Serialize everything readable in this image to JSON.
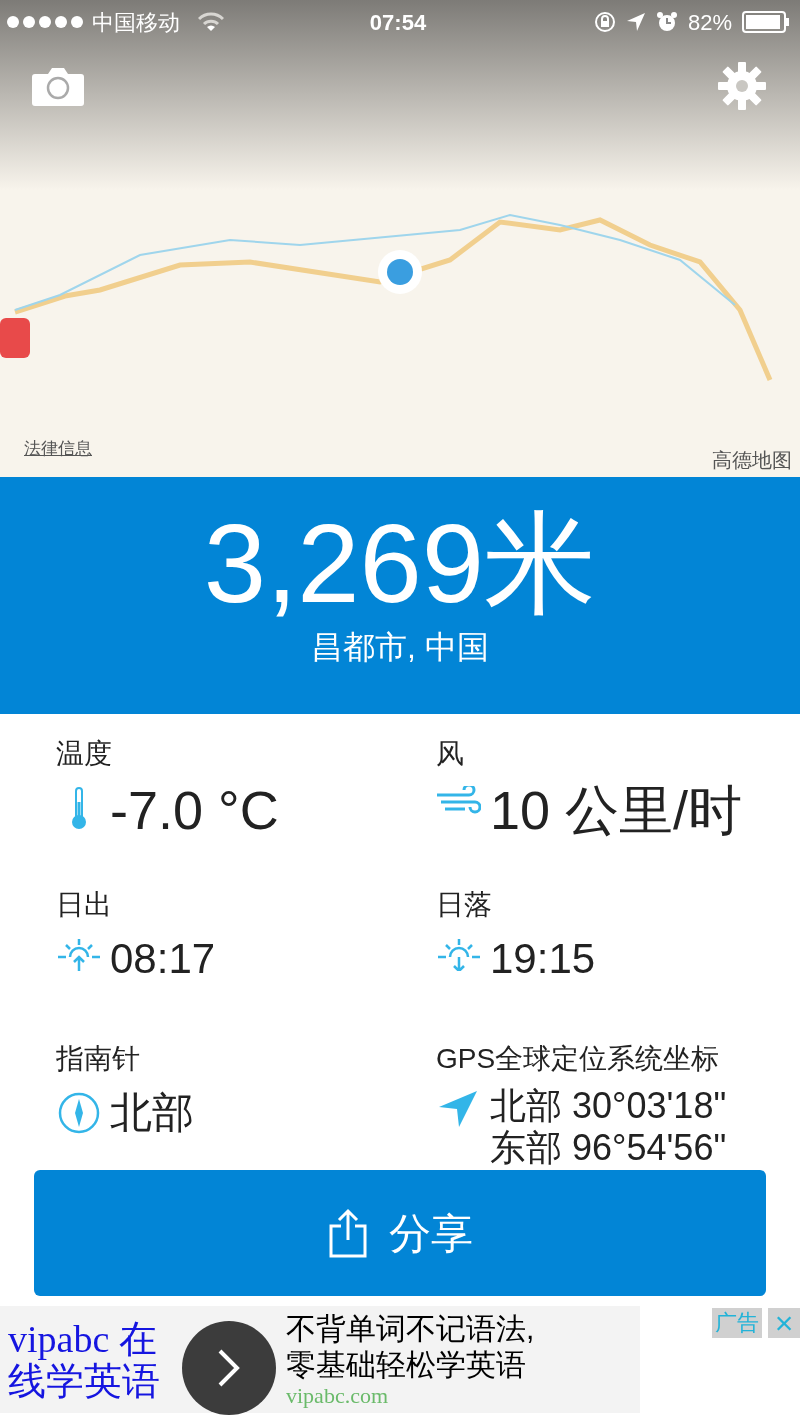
{
  "status_bar": {
    "carrier": "中国移动",
    "time": "07:54",
    "battery": "82%"
  },
  "map": {
    "legal_link": "法律信息",
    "provider": "高德地图"
  },
  "altitude": {
    "value": "3,269米",
    "location": "昌都市, 中国"
  },
  "stats": [
    {
      "kind": "temperature",
      "label": "温度",
      "lines": [
        "-7.0 °C"
      ]
    },
    {
      "kind": "wind",
      "label": "风",
      "lines": [
        "10 公里/时"
      ]
    },
    {
      "kind": "sunrise",
      "label": "日出",
      "lines": [
        "08:17"
      ]
    },
    {
      "kind": "sunset",
      "label": "日落",
      "lines": [
        "19:15"
      ]
    },
    {
      "kind": "compass",
      "label": "指南针",
      "lines": [
        "北部"
      ]
    },
    {
      "kind": "gps",
      "label": "GPS全球定位系统坐标",
      "lines": [
        "北部 30°03'18\"",
        "东部 96°54'56\""
      ]
    }
  ],
  "share_button": {
    "label": "分享"
  },
  "ad": {
    "headline": "vipabc 在线学英语",
    "text_lines": [
      "不背单词不记语法,",
      "零基础轻松学英语"
    ],
    "url": "vipabc.com",
    "badge": "广告",
    "close": "×"
  }
}
